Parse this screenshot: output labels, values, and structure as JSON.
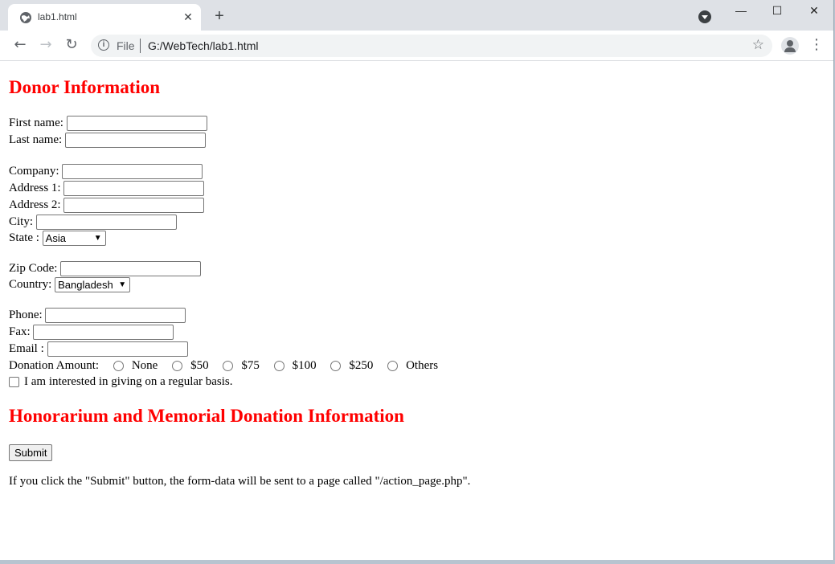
{
  "browser": {
    "tab_title": "lab1.html",
    "tab_close": "✕",
    "new_tab": "+",
    "scheme_label": "File",
    "url": "G:/WebTech/lab1.html",
    "window_minimize": "—",
    "window_maximize": "☐",
    "window_close": "✕"
  },
  "page": {
    "heading_donor": "Donor Information",
    "labels": {
      "first_name": "First name:",
      "last_name": "Last name:",
      "company": "Company:",
      "address1": "Address 1:",
      "address2": "Address 2:",
      "city": "City:",
      "state": "State :",
      "zip": "Zip Code:",
      "country": "Country:",
      "phone": "Phone:",
      "fax": "Fax:",
      "email": "Email :",
      "donation_amount": "Donation Amount:"
    },
    "state_selected": "Asia",
    "country_selected": "Bangladesh",
    "donation_options": [
      "None",
      "$50",
      "$75",
      "$100",
      "$250",
      "Others"
    ],
    "regular_basis": "I am interested in giving on a regular basis.",
    "heading_honorarium": "Honorarium and Memorial Donation Information",
    "submit_label": "Submit",
    "footer_note": "If you click the \"Submit\" button, the form-data will be sent to a page called \"/action_page.php\"."
  },
  "icons": [
    "globe-icon",
    "tab-search-icon",
    "back-icon",
    "forward-icon",
    "reload-icon",
    "info-icon",
    "star-icon",
    "profile-icon",
    "menu-icon"
  ]
}
